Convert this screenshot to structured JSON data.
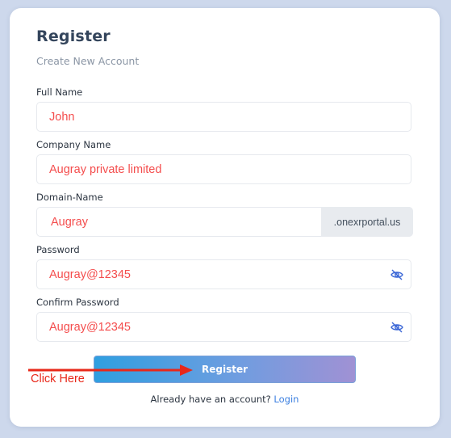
{
  "form": {
    "title": "Register",
    "subtitle": "Create New Account",
    "full_name": {
      "label": "Full Name",
      "value": "John"
    },
    "company_name": {
      "label": "Company Name",
      "value": "Augray private limited"
    },
    "domain_name": {
      "label": "Domain-Name",
      "value": "Augray",
      "suffix": ".onexrportal.us"
    },
    "password": {
      "label": "Password",
      "value": "Augray@12345",
      "icon": "eye-slash-icon"
    },
    "confirm_password": {
      "label": "Confirm Password",
      "value": "Augray@12345",
      "icon": "eye-slash-icon"
    },
    "submit_label": "Register",
    "footer_text": "Already have an account?",
    "login_link": "Login"
  },
  "annotation": {
    "text": "Click Here",
    "color": "#e8281a"
  },
  "colors": {
    "background": "#cdd8ec",
    "value_text": "#f44d4d",
    "link": "#3b7fe0"
  }
}
